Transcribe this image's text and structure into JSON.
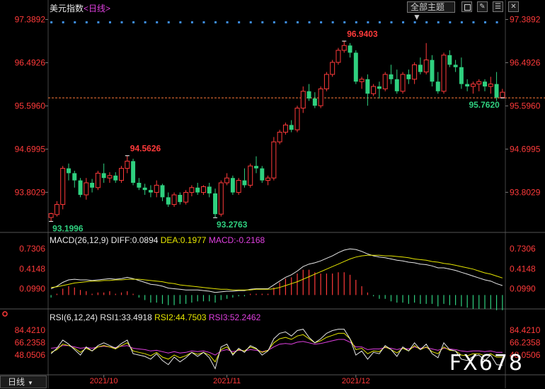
{
  "header": {
    "title": "美元指数",
    "period_prefix": "<",
    "period": "日线",
    "period_suffix": ">",
    "subject_button": "全部主题",
    "icons": [
      "stop-icon",
      "ruler-icon",
      "list-icon",
      "close-icon"
    ]
  },
  "watermark": "FX678",
  "bottom_tab": "日线",
  "colors": {
    "up": "#ff3a3a",
    "down": "#2fd07f",
    "dots": "#3d8ee6",
    "diff": "#e8e8e8",
    "dea": "#e6e600",
    "rsi3": "#e040e0"
  },
  "chart_data": [
    {
      "type": "candlestick",
      "title": "美元指数",
      "period": "日线",
      "yticks": [
        "97.3892",
        "96.4926",
        "95.5960",
        "94.6995",
        "93.8029"
      ],
      "ylim": [
        93.0,
        97.5
      ],
      "current_line": 95.762,
      "annotations": [
        {
          "text": "93.1996",
          "value": 93.1996,
          "index": 0
        },
        {
          "text": "94.5626",
          "value": 94.5626,
          "index": 13
        },
        {
          "text": "93.2763",
          "value": 93.2763,
          "index": 28
        },
        {
          "text": "96.9403",
          "value": 96.9403,
          "index": 50
        },
        {
          "text": "95.7620",
          "value": 95.762,
          "index": 77
        }
      ],
      "xlabels": [
        "2021/10",
        "2021/11",
        "2021/12"
      ],
      "xlabel_index": [
        9,
        30,
        52
      ],
      "candles": [
        [
          93.28,
          93.38,
          93.2,
          93.36
        ],
        [
          93.34,
          93.62,
          93.3,
          93.55
        ],
        [
          93.55,
          94.35,
          93.45,
          94.3
        ],
        [
          94.3,
          94.4,
          94.05,
          94.2
        ],
        [
          94.2,
          94.25,
          93.9,
          94.05
        ],
        [
          94.05,
          94.1,
          93.7,
          93.75
        ],
        [
          93.75,
          94.1,
          93.65,
          94.0
        ],
        [
          94.0,
          94.08,
          93.8,
          93.9
        ],
        [
          93.9,
          94.25,
          93.85,
          94.2
        ],
        [
          94.2,
          94.4,
          94.0,
          94.1
        ],
        [
          94.1,
          94.22,
          94.0,
          94.15
        ],
        [
          94.15,
          94.22,
          94.0,
          94.05
        ],
        [
          94.05,
          94.35,
          94.0,
          94.3
        ],
        [
          94.3,
          94.56,
          94.2,
          94.45
        ],
        [
          94.45,
          94.5,
          93.95,
          94.0
        ],
        [
          94.0,
          94.1,
          93.85,
          93.9
        ],
        [
          93.9,
          93.98,
          93.75,
          93.85
        ],
        [
          93.85,
          93.95,
          93.7,
          93.8
        ],
        [
          93.8,
          94.05,
          93.7,
          93.95
        ],
        [
          93.95,
          93.98,
          93.62,
          93.7
        ],
        [
          93.7,
          93.8,
          93.5,
          93.55
        ],
        [
          93.55,
          93.8,
          93.5,
          93.75
        ],
        [
          93.75,
          93.8,
          93.55,
          93.6
        ],
        [
          93.6,
          93.85,
          93.55,
          93.8
        ],
        [
          93.8,
          93.95,
          93.72,
          93.9
        ],
        [
          93.9,
          94.0,
          93.75,
          93.8
        ],
        [
          93.8,
          93.95,
          93.75,
          93.92
        ],
        [
          93.92,
          94.0,
          93.7,
          93.78
        ],
        [
          93.78,
          93.88,
          93.27,
          93.35
        ],
        [
          93.35,
          94.05,
          93.3,
          94.0
        ],
        [
          94.0,
          94.2,
          93.95,
          94.1
        ],
        [
          94.1,
          94.15,
          93.75,
          93.8
        ],
        [
          93.8,
          94.1,
          93.75,
          94.05
        ],
        [
          94.05,
          94.3,
          93.9,
          93.95
        ],
        [
          93.95,
          94.4,
          93.9,
          94.35
        ],
        [
          94.35,
          94.55,
          94.2,
          94.3
        ],
        [
          94.3,
          94.35,
          94.0,
          94.05
        ],
        [
          94.05,
          94.15,
          93.95,
          94.1
        ],
        [
          94.1,
          94.95,
          94.05,
          94.85
        ],
        [
          94.85,
          95.1,
          94.8,
          95.05
        ],
        [
          95.05,
          95.25,
          95.0,
          95.2
        ],
        [
          95.2,
          95.3,
          95.05,
          95.1
        ],
        [
          95.1,
          95.6,
          95.05,
          95.55
        ],
        [
          95.55,
          96.0,
          95.45,
          95.9
        ],
        [
          95.9,
          96.05,
          95.7,
          95.75
        ],
        [
          95.75,
          95.88,
          95.55,
          95.6
        ],
        [
          95.6,
          96.0,
          95.55,
          95.95
        ],
        [
          95.95,
          96.3,
          95.9,
          96.25
        ],
        [
          96.25,
          96.55,
          96.2,
          96.5
        ],
        [
          96.5,
          96.8,
          96.45,
          96.75
        ],
        [
          96.75,
          96.94,
          96.7,
          96.85
        ],
        [
          96.85,
          96.9,
          96.6,
          96.7
        ],
        [
          96.7,
          96.75,
          96.05,
          96.1
        ],
        [
          96.1,
          96.2,
          95.95,
          96.15
        ],
        [
          96.15,
          96.25,
          95.6,
          95.85
        ],
        [
          95.85,
          96.05,
          95.8,
          96.0
        ],
        [
          96.0,
          96.1,
          95.75,
          95.95
        ],
        [
          95.95,
          96.3,
          95.9,
          96.25
        ],
        [
          96.25,
          96.45,
          96.05,
          96.15
        ],
        [
          96.15,
          96.35,
          95.85,
          95.9
        ],
        [
          95.9,
          96.3,
          95.85,
          96.25
        ],
        [
          96.25,
          96.35,
          96.05,
          96.15
        ],
        [
          96.15,
          96.5,
          96.05,
          96.45
        ],
        [
          96.45,
          96.6,
          96.25,
          96.3
        ],
        [
          96.3,
          96.9,
          96.25,
          96.55
        ],
        [
          96.55,
          96.65,
          96.0,
          96.1
        ],
        [
          96.1,
          96.3,
          95.85,
          95.9
        ],
        [
          95.9,
          96.7,
          95.85,
          96.65
        ],
        [
          96.65,
          96.75,
          96.4,
          96.45
        ],
        [
          96.45,
          96.55,
          96.3,
          96.4
        ],
        [
          96.4,
          96.6,
          95.95,
          96.05
        ],
        [
          96.05,
          96.15,
          95.9,
          96.0
        ],
        [
          96.0,
          96.1,
          95.85,
          96.05
        ],
        [
          96.05,
          96.15,
          95.9,
          96.1
        ],
        [
          96.1,
          96.15,
          95.9,
          96.0
        ],
        [
          96.0,
          96.2,
          95.85,
          96.05
        ],
        [
          96.05,
          96.3,
          95.7,
          95.77
        ],
        [
          95.77,
          95.95,
          95.76,
          95.88
        ]
      ]
    },
    {
      "type": "macd",
      "title": "MACD(26,12,9)",
      "diff_label": "DIFF:0.0894",
      "dea_label": "DEA:0.1977",
      "macd_label": "MACD:-0.2168",
      "yticks": [
        "0.7306",
        "0.4148",
        "0.0990"
      ],
      "ylim": [
        -0.22,
        0.8
      ],
      "diff": [
        0.1,
        0.14,
        0.2,
        0.24,
        0.25,
        0.24,
        0.24,
        0.23,
        0.24,
        0.25,
        0.26,
        0.25,
        0.26,
        0.28,
        0.26,
        0.23,
        0.2,
        0.17,
        0.16,
        0.14,
        0.11,
        0.1,
        0.09,
        0.08,
        0.08,
        0.08,
        0.07,
        0.06,
        0.04,
        0.05,
        0.06,
        0.06,
        0.07,
        0.07,
        0.09,
        0.1,
        0.1,
        0.1,
        0.16,
        0.22,
        0.28,
        0.32,
        0.38,
        0.45,
        0.49,
        0.51,
        0.54,
        0.58,
        0.62,
        0.67,
        0.71,
        0.73,
        0.72,
        0.69,
        0.65,
        0.62,
        0.6,
        0.59,
        0.57,
        0.55,
        0.54,
        0.52,
        0.51,
        0.49,
        0.48,
        0.46,
        0.43,
        0.43,
        0.41,
        0.39,
        0.36,
        0.33,
        0.3,
        0.27,
        0.24,
        0.22,
        0.18,
        0.15
      ],
      "dea": [
        0.12,
        0.13,
        0.15,
        0.17,
        0.19,
        0.2,
        0.21,
        0.22,
        0.22,
        0.23,
        0.23,
        0.24,
        0.24,
        0.25,
        0.25,
        0.25,
        0.24,
        0.23,
        0.22,
        0.21,
        0.19,
        0.18,
        0.16,
        0.15,
        0.14,
        0.13,
        0.12,
        0.11,
        0.1,
        0.09,
        0.09,
        0.08,
        0.08,
        0.08,
        0.08,
        0.09,
        0.09,
        0.09,
        0.1,
        0.12,
        0.15,
        0.18,
        0.21,
        0.25,
        0.29,
        0.33,
        0.37,
        0.41,
        0.45,
        0.49,
        0.53,
        0.57,
        0.6,
        0.62,
        0.63,
        0.63,
        0.63,
        0.62,
        0.62,
        0.61,
        0.6,
        0.59,
        0.57,
        0.56,
        0.55,
        0.53,
        0.52,
        0.5,
        0.49,
        0.47,
        0.45,
        0.43,
        0.41,
        0.38,
        0.35,
        0.33,
        0.3,
        0.27
      ]
    },
    {
      "type": "rsi",
      "title": "RSI(6,12,24)",
      "rsi1_label": "RSI1:33.4918",
      "rsi2_label": "RSI2:44.7503",
      "rsi3_label": "RSI3:52.2462",
      "yticks": [
        "84.4210",
        "66.2358",
        "48.0506"
      ],
      "ylim": [
        20,
        96
      ],
      "rsi1": [
        50,
        58,
        70,
        64,
        56,
        48,
        60,
        54,
        62,
        66,
        62,
        58,
        65,
        70,
        50,
        48,
        46,
        42,
        50,
        40,
        34,
        45,
        38,
        44,
        52,
        46,
        52,
        44,
        28,
        60,
        64,
        48,
        58,
        52,
        62,
        58,
        48,
        54,
        72,
        80,
        82,
        76,
        84,
        86,
        74,
        66,
        72,
        80,
        84,
        86,
        86,
        72,
        48,
        54,
        42,
        52,
        50,
        62,
        56,
        46,
        60,
        54,
        66,
        56,
        64,
        50,
        44,
        66,
        56,
        54,
        42,
        40,
        46,
        48,
        40,
        48,
        34,
        33
      ],
      "rsi2": [
        52,
        56,
        64,
        62,
        58,
        52,
        58,
        54,
        60,
        62,
        60,
        57,
        62,
        66,
        54,
        52,
        50,
        47,
        52,
        45,
        42,
        48,
        44,
        47,
        52,
        49,
        52,
        48,
        38,
        56,
        60,
        50,
        56,
        54,
        60,
        57,
        52,
        55,
        66,
        72,
        74,
        71,
        76,
        78,
        72,
        66,
        69,
        74,
        77,
        80,
        80,
        72,
        56,
        58,
        50,
        54,
        53,
        60,
        56,
        51,
        58,
        54,
        62,
        56,
        60,
        53,
        50,
        60,
        55,
        54,
        48,
        47,
        50,
        50,
        47,
        50,
        45,
        45
      ],
      "rsi3": [
        58,
        59,
        62,
        62,
        60,
        58,
        59,
        58,
        60,
        61,
        60,
        59,
        61,
        62,
        58,
        57,
        56,
        54,
        55,
        53,
        51,
        53,
        51,
        52,
        54,
        53,
        54,
        52,
        48,
        54,
        56,
        53,
        55,
        54,
        56,
        55,
        53,
        55,
        60,
        64,
        65,
        64,
        67,
        68,
        66,
        64,
        65,
        67,
        69,
        71,
        71,
        67,
        60,
        60,
        56,
        57,
        57,
        59,
        58,
        56,
        58,
        57,
        60,
        58,
        59,
        57,
        55,
        58,
        57,
        56,
        54,
        53,
        54,
        54,
        53,
        54,
        52,
        52
      ]
    }
  ]
}
